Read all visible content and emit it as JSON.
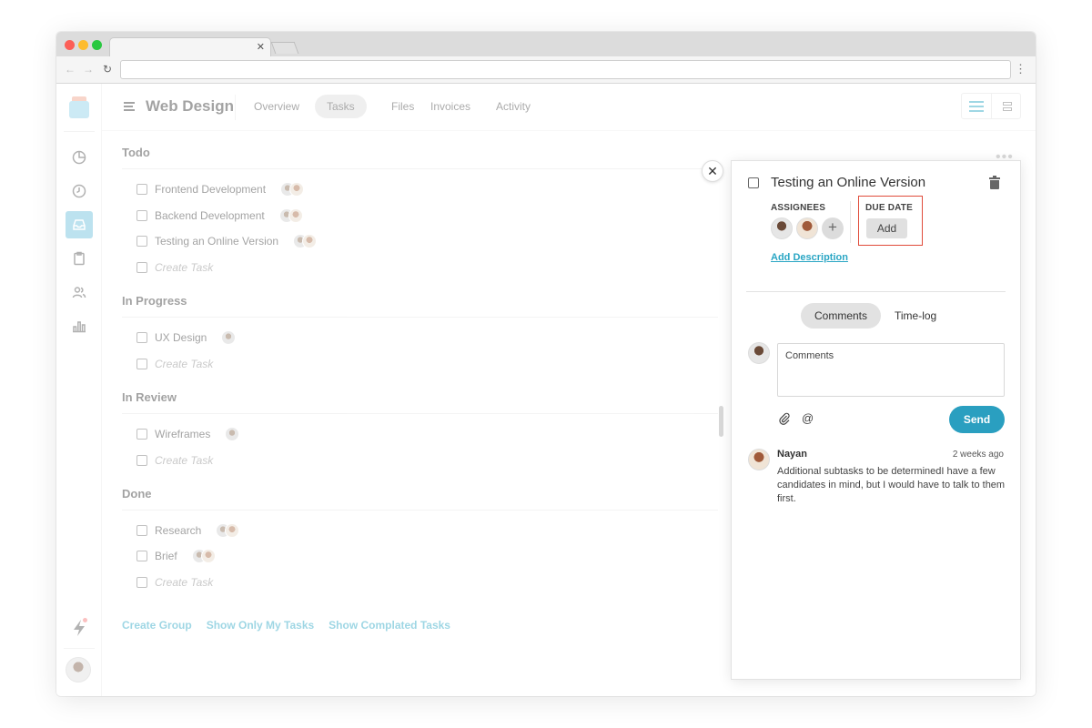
{
  "project": {
    "title": "Web Design",
    "tabs": [
      {
        "label": "Overview"
      },
      {
        "label": "Tasks"
      },
      {
        "label": "Files"
      },
      {
        "label": "Invoices"
      },
      {
        "label": "Activity"
      }
    ],
    "active_tab": "Tasks"
  },
  "sidebar": {
    "items": [
      {
        "icon": "pie-chart-icon"
      },
      {
        "icon": "clock-icon"
      },
      {
        "icon": "inbox-icon",
        "active": true
      },
      {
        "icon": "clipboard-icon"
      },
      {
        "icon": "users-icon"
      },
      {
        "icon": "bar-chart-icon"
      }
    ]
  },
  "groups": [
    {
      "title": "Todo",
      "tasks": [
        {
          "label": "Frontend Development"
        },
        {
          "label": "Backend Development"
        },
        {
          "label": "Testing an Online Version"
        }
      ]
    },
    {
      "title": "In Progress",
      "tasks": [
        {
          "label": "UX Design"
        }
      ]
    },
    {
      "title": "In Review",
      "tasks": [
        {
          "label": "Wireframes"
        }
      ]
    },
    {
      "title": "Done",
      "tasks": [
        {
          "label": "Research"
        },
        {
          "label": "Brief"
        }
      ]
    }
  ],
  "create_task_label": "Create Task",
  "footer_links": {
    "create_group": "Create Group",
    "show_my_tasks": "Show Only My Tasks",
    "show_completed": "Show Complated Tasks"
  },
  "panel": {
    "title": "Testing an Online Version",
    "assignees_label": "ASSIGNEES",
    "due_date_label": "DUE DATE",
    "due_date_button": "Add",
    "add_description": "Add Description",
    "tabs": {
      "comments": "Comments",
      "timelog": "Time-log"
    },
    "comment_placeholder": "Comments",
    "send_label": "Send",
    "comment": {
      "author": "Nayan",
      "time": "2 weeks ago",
      "text": "Additional subtasks to be determinedI have a few candidates in mind, but I would have to talk to them first."
    }
  },
  "colors": {
    "accent": "#2aa6c4",
    "highlight_border": "#e04b3a"
  }
}
